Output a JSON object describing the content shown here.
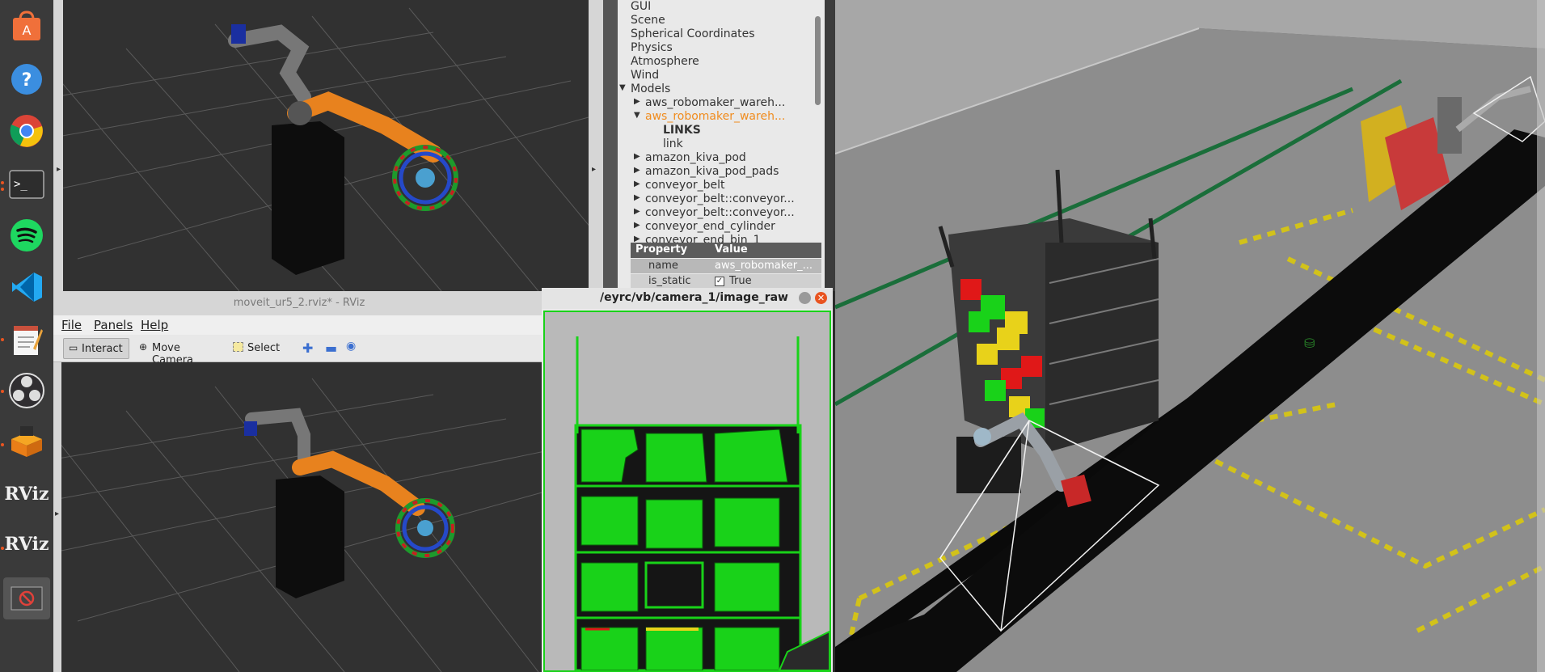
{
  "dock": {
    "items": [
      {
        "name": "software-center-icon"
      },
      {
        "name": "help-icon"
      },
      {
        "name": "chrome-icon"
      },
      {
        "name": "terminal-icon"
      },
      {
        "name": "spotify-icon"
      },
      {
        "name": "vscode-icon"
      },
      {
        "name": "text-editor-icon"
      },
      {
        "name": "obs-icon"
      },
      {
        "name": "archive-icon"
      },
      {
        "name": "rviz-icon",
        "label": "RViz"
      },
      {
        "name": "rviz-icon",
        "label": "RViz"
      },
      {
        "name": "blocked-icon"
      }
    ]
  },
  "rviz_window": {
    "title": "moveit_ur5_2.rviz* - RViz",
    "menu": [
      "File",
      "Panels",
      "Help"
    ],
    "toolbar": {
      "interact": "Interact",
      "move_camera": "Move Camera",
      "select": "Select"
    }
  },
  "gazebo_tree": {
    "items": [
      {
        "label": "GUI",
        "indent": 0,
        "arrow": ""
      },
      {
        "label": "Scene",
        "indent": 0,
        "arrow": ""
      },
      {
        "label": "Spherical Coordinates",
        "indent": 0,
        "arrow": ""
      },
      {
        "label": "Physics",
        "indent": 0,
        "arrow": ""
      },
      {
        "label": "Atmosphere",
        "indent": 0,
        "arrow": ""
      },
      {
        "label": "Wind",
        "indent": 0,
        "arrow": ""
      },
      {
        "label": "Models",
        "indent": 0,
        "arrow": "down"
      },
      {
        "label": "aws_robomaker_wareh...",
        "indent": 1,
        "arrow": "right"
      },
      {
        "label": "aws_robomaker_wareh...",
        "indent": 1,
        "arrow": "down",
        "selected": true
      },
      {
        "label": "LINKS",
        "indent": 2,
        "arrow": "",
        "bold": true
      },
      {
        "label": "link",
        "indent": 2,
        "arrow": ""
      },
      {
        "label": "amazon_kiva_pod",
        "indent": 1,
        "arrow": "right"
      },
      {
        "label": "amazon_kiva_pod_pads",
        "indent": 1,
        "arrow": "right"
      },
      {
        "label": "conveyor_belt",
        "indent": 1,
        "arrow": "right"
      },
      {
        "label": "conveyor_belt::conveyor...",
        "indent": 1,
        "arrow": "right"
      },
      {
        "label": "conveyor_belt::conveyor...",
        "indent": 1,
        "arrow": "right"
      },
      {
        "label": "conveyor_end_cylinder",
        "indent": 1,
        "arrow": "right"
      },
      {
        "label": "conveyor_end_bin_1",
        "indent": 1,
        "arrow": "right"
      }
    ],
    "property_header": "Property",
    "value_header": "Value",
    "properties": [
      {
        "key": "name",
        "value": "aws_robomaker_..."
      },
      {
        "key": "is_static",
        "value": "True",
        "checked": true
      }
    ]
  },
  "camera_window": {
    "title": "/eyrc/vb/camera_1/image_raw"
  },
  "colors": {
    "dock_bg": "#3a3a3a",
    "accent_orange": "#e95420",
    "selected_tree": "#f08c1e",
    "robot_orange": "#e8821e",
    "green_outline": "#19d219"
  }
}
